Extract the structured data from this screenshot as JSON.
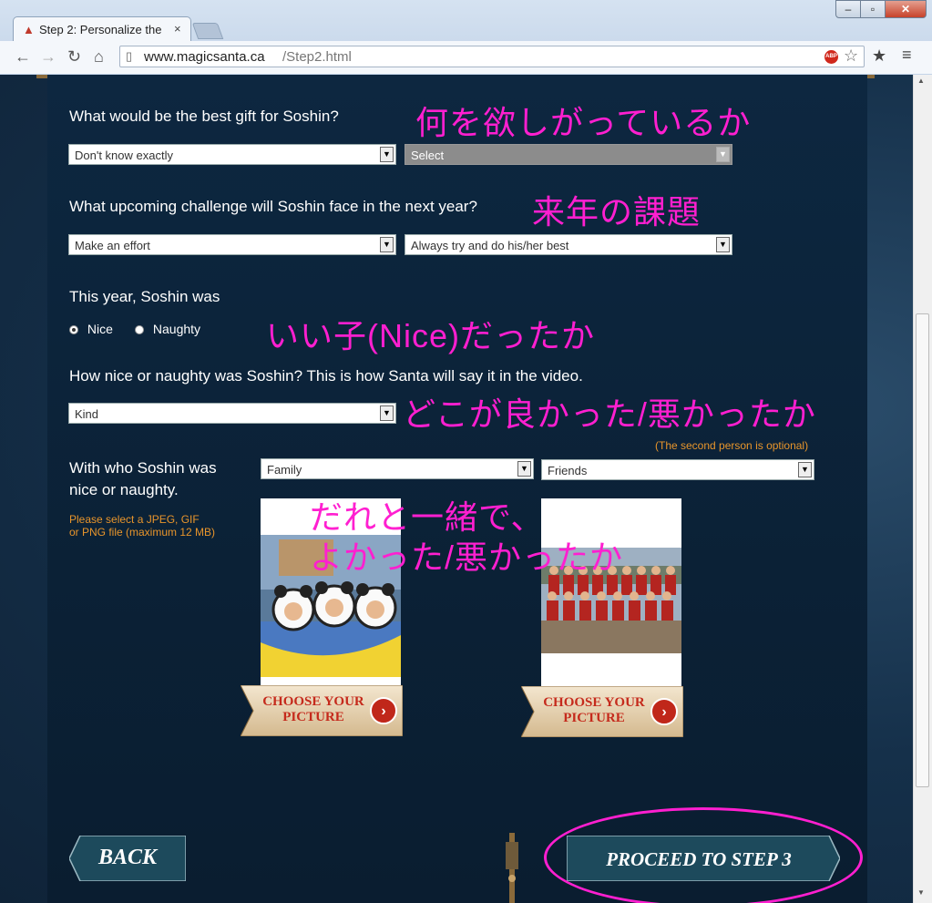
{
  "browser": {
    "tab_title": "Step 2: Personalize the",
    "tab_favicon": "santa-tree-icon",
    "url_host": "www.magicsanta.ca",
    "url_path": "/Step2.html",
    "abp_label": "ABP"
  },
  "form": {
    "q1": {
      "label": "What would be the best gift for Soshin?",
      "select1": "Don't know exactly",
      "select2": "Select"
    },
    "q2": {
      "label": "What upcoming challenge will Soshin face in the next year?",
      "select1": "Make an effort",
      "select2": "Always try and do his/her best"
    },
    "q3": {
      "label": "This year, Soshin was",
      "options": [
        "Nice",
        "Naughty"
      ],
      "selected": "Nice"
    },
    "q4": {
      "label": "How nice or naughty was Soshin? This is how Santa will say it in the video.",
      "select1": "Kind"
    },
    "q5": {
      "label_line1": "With who Soshin was",
      "label_line2": "nice or naughty.",
      "optional_note": "(The second person is optional)",
      "file_note_line1": "Please select a JPEG, GIF",
      "file_note_line2": "or PNG file (maximum 12 MB)",
      "select1": "Family",
      "select2": "Friends",
      "choose_line1": "CHOOSE YOUR",
      "choose_line2": "PICTURE"
    }
  },
  "annotations": {
    "a1": "何を欲しがっているか",
    "a2": "来年の課題",
    "a3": "いい子(Nice)だったか",
    "a4": "どこが良かった/悪かったか",
    "a5_line1": "だれと一緒で、",
    "a5_line2": "よかった/悪かったか"
  },
  "nav": {
    "back": "BACK",
    "proceed": "PROCEED TO STEP 3"
  },
  "colors": {
    "annotation": "#ff1fd0",
    "orange_note": "#e8952b",
    "panel_bg": "#0b2136"
  }
}
